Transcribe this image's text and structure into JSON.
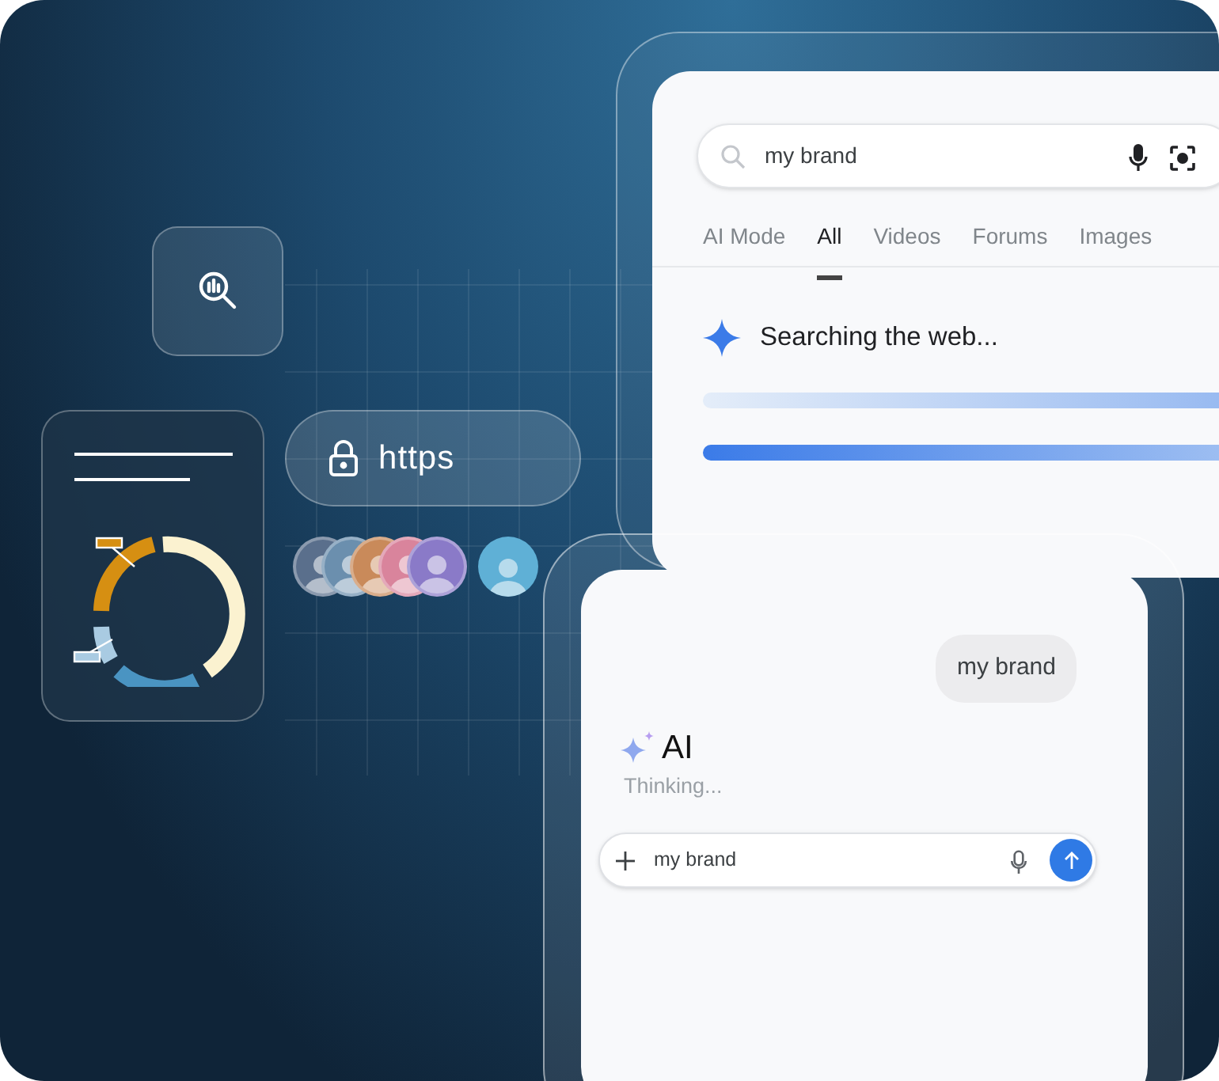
{
  "search_panel": {
    "search_field": {
      "value": "my brand"
    },
    "tabs": [
      {
        "label": "AI Mode",
        "selected": false
      },
      {
        "label": "All",
        "selected": true
      },
      {
        "label": "Videos",
        "selected": false
      },
      {
        "label": "Forums",
        "selected": false
      },
      {
        "label": "Images",
        "selected": false
      }
    ],
    "status": "Searching the web..."
  },
  "url_pill": {
    "text": "https"
  },
  "avatars": [
    {
      "color": "#5a6f8c"
    },
    {
      "color": "#6b8fae"
    },
    {
      "color": "#c98a5a"
    },
    {
      "color": "#d9849c"
    },
    {
      "color": "#8a7ac8"
    },
    {
      "color": "#5fb0d6"
    }
  ],
  "chat_panel": {
    "user_message": "my brand",
    "assistant_name": "AI",
    "assistant_status": "Thinking...",
    "input": {
      "value": "my brand"
    }
  }
}
